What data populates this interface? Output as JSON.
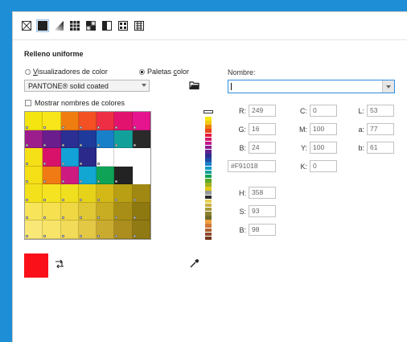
{
  "section_title": "Relleno uniforme",
  "mode": {
    "viewers_label": "Visualizadores de color",
    "palettes_label": "Paletas color",
    "selected": "palettes"
  },
  "palette": {
    "selected": "PANTONE® solid coated",
    "show_names_label": "Mostrar nombres de colores",
    "show_names_checked": false
  },
  "name": {
    "label": "Nombre:",
    "value": ""
  },
  "color": {
    "current_hex": "#F91018",
    "swatch": "#f91018",
    "R": "249",
    "G": "16",
    "B": "24",
    "C": "0",
    "M": "100",
    "Y": "100",
    "K": "0",
    "L": "53",
    "a": "77",
    "b_lab": "61",
    "H": "358",
    "S": "93",
    "Bv": "98"
  },
  "labels": {
    "R": "R:",
    "G": "G:",
    "B": "B:",
    "C": "C:",
    "M": "M:",
    "Y": "Y:",
    "K": "K:",
    "L": "L:",
    "a": "a:",
    "b_lab": "b:",
    "H": "H:",
    "S": "S:",
    "Bv": "B:"
  },
  "swatch_grid": [
    [
      "#f4e511",
      "#f9e61a",
      "#ef7d10",
      "#f35024",
      "#ee2e45",
      "#e2136f",
      "#e5158f"
    ],
    [
      "#9c1d8c",
      "#6a1d8c",
      "#2b2e92",
      "#1e3a9a",
      "#1880c8",
      "#12a19a",
      "#2a2a2a"
    ],
    [
      "#f5e018",
      "#d8126b",
      "#12a2d8",
      "#2b2a8a",
      "#ffffff",
      "",
      ""
    ],
    [
      "#f5df16",
      "#f07a14",
      "#cd1a80",
      "#12a6d2",
      "#0ea356",
      "#232323",
      ""
    ],
    [
      "#f3e11c",
      "#f5e322",
      "#f0df1e",
      "#e7d21a",
      "#d4b818",
      "#b89f14",
      "#a08812"
    ],
    [
      "#f7e45a",
      "#f6e050",
      "#f0d844",
      "#e0c734",
      "#c8ac22",
      "#a88e16",
      "#8e7810"
    ],
    [
      "#f9e878",
      "#f8e468",
      "#f2db58",
      "#e3c846",
      "#c9ab30",
      "#ab8e1e",
      "#907a14"
    ]
  ],
  "strip_colors": [
    "#f4e511",
    "#f0c818",
    "#ee7d10",
    "#e8451e",
    "#e21a3a",
    "#d01a66",
    "#c0188e",
    "#8e1e8c",
    "#5e2290",
    "#2e2e92",
    "#1e4aa2",
    "#1a80c8",
    "#129ac8",
    "#12a19a",
    "#0ea356",
    "#5aa82a",
    "#a0b420",
    "#e0c81a",
    "#999999",
    "#2a2a2a",
    "#e8d050",
    "#c8b040",
    "#a89a38",
    "#8a8030",
    "#6e6a28",
    "#f0a040",
    "#d07838",
    "#b06030",
    "#904828",
    "#703820"
  ],
  "icons": [
    "no-fill-icon",
    "uniform-fill-icon",
    "fountain-fill-icon",
    "vector-pattern-icon",
    "bitmap-pattern-icon",
    "two-color-pattern-icon",
    "texture-fill-icon",
    "postscript-fill-icon",
    "open-palette-icon",
    "swap-icon",
    "eyedropper-icon"
  ]
}
